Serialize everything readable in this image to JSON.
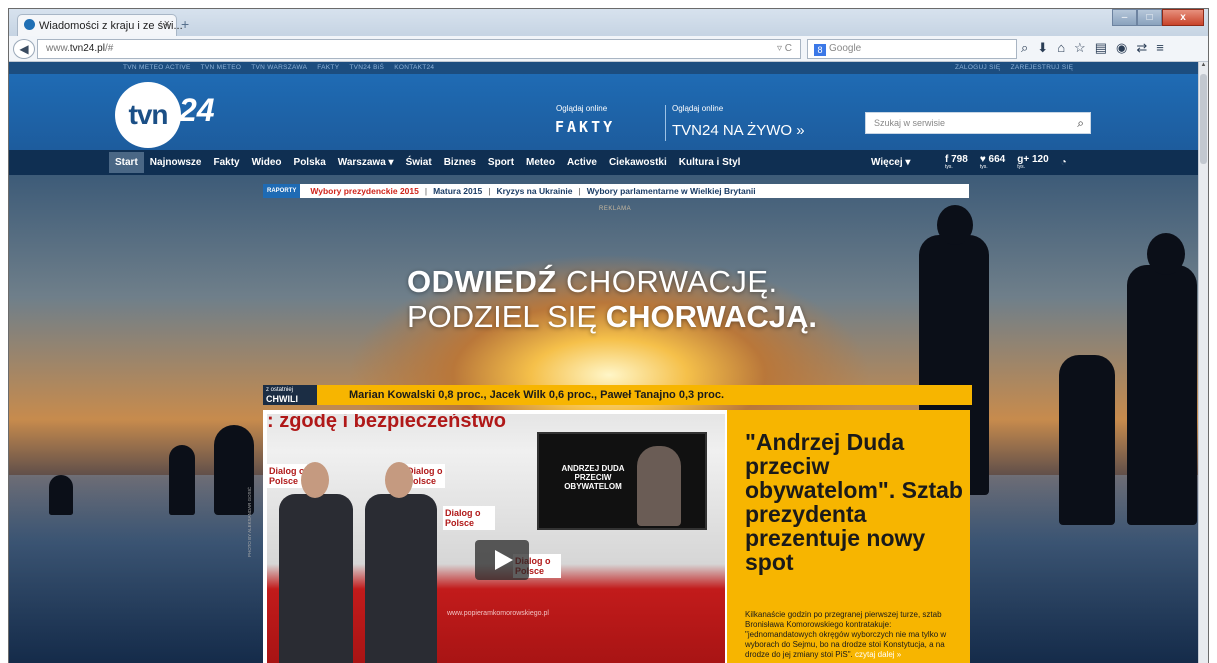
{
  "browser": {
    "tab_title": "Wiadomości z kraju i ze świ...",
    "tab_close": "×",
    "new_tab": "+",
    "url_prefix": "www.",
    "url_domain": "tvn24.pl",
    "url_suffix": "/#",
    "search_engine": "Google",
    "window_min": "–",
    "window_max": "□",
    "window_close": "x"
  },
  "top_strip": {
    "left_links": [
      "TVN METEO ACTIVE",
      "TVN METEO",
      "TVN WARSZAWA",
      "FAKTY",
      "TVN24 BiŚ",
      "KONTAKT24"
    ],
    "right_links": [
      "ZALOGUJ SIĘ",
      "ZAREJESTRUJ SIĘ"
    ]
  },
  "header": {
    "logo_text": "tvn",
    "logo_num": "24",
    "watch_online_1": "Oglądaj online",
    "fakty": "FAKTY",
    "watch_online_2": "Oglądaj online",
    "live_link": "TVN24 NA ŻYWO »",
    "search_placeholder": "Szukaj w serwisie"
  },
  "menu": {
    "items": [
      "Start",
      "Najnowsze",
      "Fakty",
      "Wideo",
      "Polska",
      "Warszawa ▾",
      "Świat",
      "Biznes",
      "Sport",
      "Meteo",
      "Active",
      "Ciekawostki",
      "Kultura i Styl"
    ],
    "more": "Więcej ▾",
    "facebook_count": "798",
    "twitter_count": "664",
    "gplus_count": "120",
    "count_unit": "tys."
  },
  "reports": {
    "tag": "RAPORTY",
    "items": [
      "Wybory prezydenckie 2015",
      "Matura 2015",
      "Kryzys na Ukrainie",
      "Wybory parlamentarne w Wielkiej Brytanii"
    ]
  },
  "ad": {
    "reklama": "REKLAMA",
    "line1_bold": "ODWIEDŹ",
    "line1_thin": " CHORWACJĘ.",
    "line2_thin": "PODZIEL SIĘ ",
    "line2_bold": "CHORWACJĄ."
  },
  "breaking": {
    "label_small": "z ostatniej",
    "label_big": "CHWILI",
    "text": "Marian Kowalski 0,8 proc., Jacek Wilk 0,6 proc., Paweł Tanajno 0,3 proc."
  },
  "story": {
    "slogan": ": zgodę i bezpieczeństwo",
    "tv_text": "ANDRZEJ DUDA PRZECIW OBYWATELOM",
    "dialog": "Dialog o Polsce",
    "video_url": "www.popieramkomorowskiego.pl",
    "photo_credit": "PHOTO BY ALEKSANDAR GOSIĆ",
    "headline": "\"Andrzej Duda przeciw obywatelom\". Sztab prezydenta prezentuje nowy spot",
    "lead": "Kilkanaście godzin po przegranej pierwszej turze, sztab Bronisława Komorowskiego kontratakuje: \"jednomandatowych okręgów wyborczych nie ma tylko w wyborach do Sejmu, bo na drodze stoi Konstytucja, a na drodze do jej zmiany stoi PiS\".",
    "read_more": " czytaj dalej »"
  }
}
